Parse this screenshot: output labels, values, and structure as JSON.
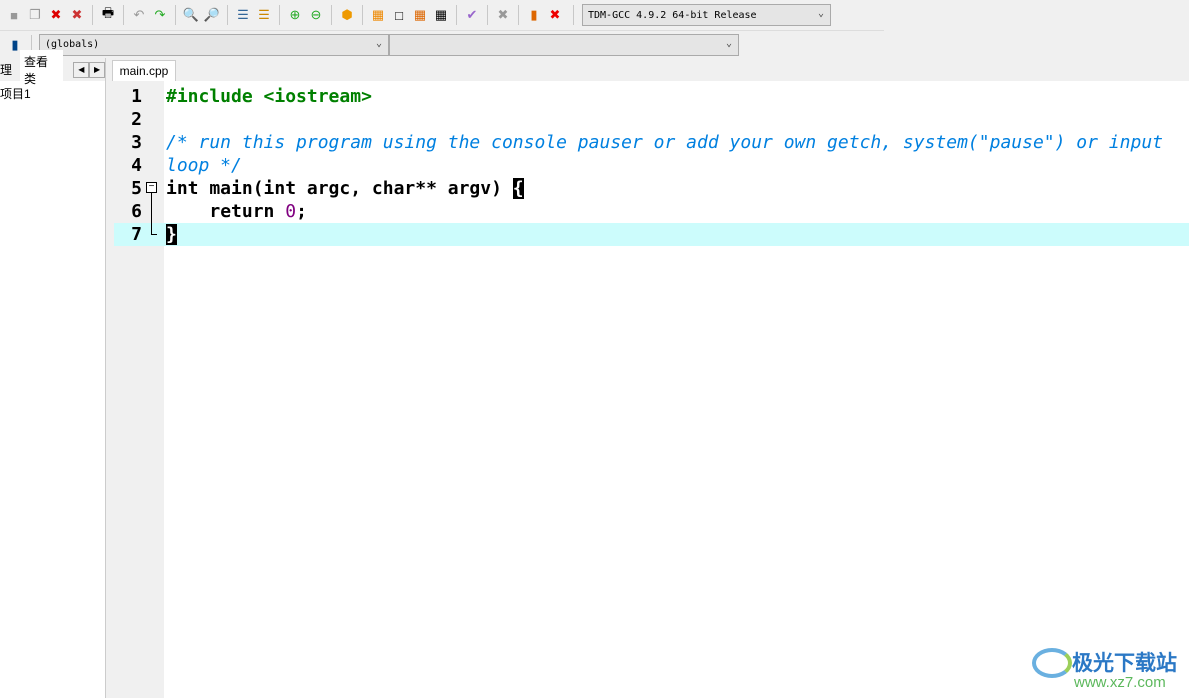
{
  "toolbar": {
    "compiler": "TDM-GCC 4.9.2 64-bit Release",
    "icons": [
      "new-icon",
      "copy-icon",
      "close-file-icon",
      "close-all-icon",
      "print-icon",
      "undo-icon",
      "redo-icon",
      "find-icon",
      "replace-icon",
      "indent-icon",
      "unindent-icon",
      "goto-icon",
      "bookmark-icon",
      "bug-icon",
      "compile-icon",
      "run-icon",
      "compile-run-icon",
      "rebuild-icon",
      "syntax-check-icon",
      "stop-icon",
      "profile-icon",
      "delete-profile-icon"
    ]
  },
  "toolbar2": {
    "scope": "(globals)",
    "member": ""
  },
  "left_panel": {
    "tabs": [
      "理",
      "查看类"
    ],
    "tree_item": "项目1"
  },
  "editor": {
    "tab": "main.cpp",
    "lines": [
      {
        "n": "1",
        "parts": [
          {
            "t": "#include <iostream>",
            "c": "pp"
          }
        ]
      },
      {
        "n": "2",
        "parts": []
      },
      {
        "n": "3",
        "parts": [
          {
            "t": "/* run this program using the console pauser or add your own getch, system(\"pause\") or input loop */",
            "c": "cm"
          }
        ]
      },
      {
        "n": "4",
        "parts": []
      },
      {
        "n": "5",
        "parts": [
          {
            "t": "int main(int argc, char** argv) ",
            "c": ""
          },
          {
            "t": "{",
            "c": "br"
          }
        ]
      },
      {
        "n": "6",
        "parts": [
          {
            "t": "    return ",
            "c": ""
          },
          {
            "t": "0",
            "c": "num"
          },
          {
            "t": ";",
            "c": ""
          }
        ]
      },
      {
        "n": "7",
        "parts": [
          {
            "t": "}",
            "c": "br"
          }
        ]
      }
    ]
  },
  "watermark": {
    "title": "极光下载站",
    "url": "www.xz7.com"
  }
}
